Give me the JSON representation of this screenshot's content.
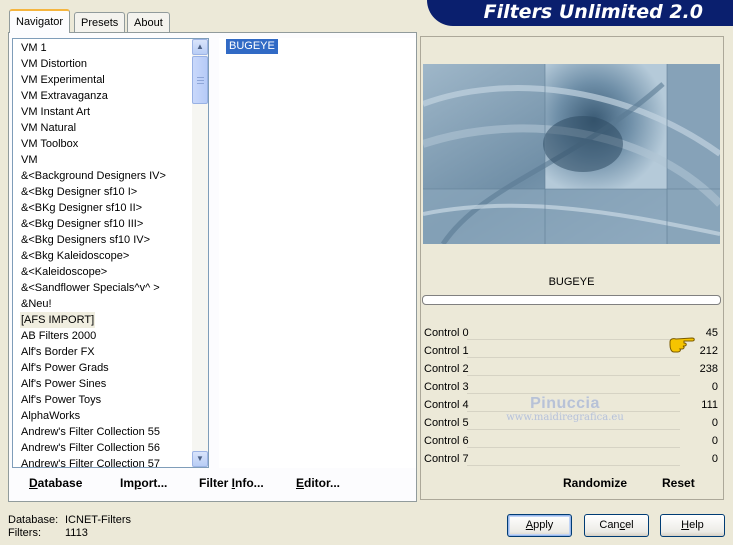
{
  "tabs": [
    {
      "label": "Navigator",
      "active": true
    },
    {
      "label": "Presets",
      "active": false
    },
    {
      "label": "About",
      "active": false
    }
  ],
  "categories": {
    "items": [
      "VM 1",
      "VM Distortion",
      "VM Experimental",
      "VM Extravaganza",
      "VM Instant Art",
      "VM Natural",
      "VM Toolbox",
      "VM",
      "&<Background Designers IV>",
      "&<Bkg Designer sf10 I>",
      "&<BKg Designer sf10 II>",
      "&<Bkg Designer sf10 III>",
      "&<Bkg Designers sf10 IV>",
      "&<Bkg Kaleidoscope>",
      "&<Kaleidoscope>",
      "&<Sandflower Specials^v^ >",
      "&Neu!",
      "[AFS IMPORT]",
      "AB Filters 2000",
      "Alf's Border FX",
      "Alf's Power Grads",
      "Alf's Power Sines",
      "Alf's Power Toys",
      "AlphaWorks",
      "Andrew's Filter Collection 55",
      "Andrew's Filter Collection 56",
      "Andrew's Filter Collection 57"
    ],
    "selected": "[AFS IMPORT]"
  },
  "filters": {
    "items": [
      "BUGEYE"
    ],
    "selected": "BUGEYE"
  },
  "nav_buttons": {
    "database": {
      "u": "D",
      "rest": "atabase"
    },
    "import": {
      "pre": "Im",
      "u": "p",
      "rest": "ort..."
    },
    "filter_info": {
      "pre": "Filter ",
      "u": "I",
      "rest": "nfo..."
    },
    "editor": {
      "u": "E",
      "rest": "ditor..."
    }
  },
  "banner": {
    "title": "Filters Unlimited 2.0"
  },
  "preview": {
    "filter_name": "BUGEYE",
    "progress_percent": 0
  },
  "controls": [
    {
      "label": "Control 0",
      "value": "45"
    },
    {
      "label": "Control 1",
      "value": "212"
    },
    {
      "label": "Control 2",
      "value": "238"
    },
    {
      "label": "Control 3",
      "value": "0"
    },
    {
      "label": "Control 4",
      "value": "111"
    },
    {
      "label": "Control 5",
      "value": "0"
    },
    {
      "label": "Control 6",
      "value": "0"
    },
    {
      "label": "Control 7",
      "value": "0"
    }
  ],
  "watermark": {
    "line1": "Pinuccia",
    "line2": "www.maidiregrafica.eu"
  },
  "right_buttons": {
    "randomize": "Randomize",
    "reset": "Reset"
  },
  "status": {
    "database_label": "Database:",
    "database_value": "ICNET-Filters",
    "filters_label": "Filters:",
    "filters_value": "1113"
  },
  "dialog_buttons": {
    "apply": {
      "u": "A",
      "rest": "pply"
    },
    "cancel": {
      "pre": "Can",
      "u": "c",
      "rest": "el"
    },
    "help": {
      "u": "H",
      "rest": "elp"
    }
  },
  "colors": {
    "selection": "#316ac5",
    "banner": "#0a1f6e",
    "preview": "#7f9cb3"
  },
  "icons": [
    "scroll-up-arrow-icon",
    "scroll-down-arrow-icon",
    "pointing-hand-icon"
  ]
}
